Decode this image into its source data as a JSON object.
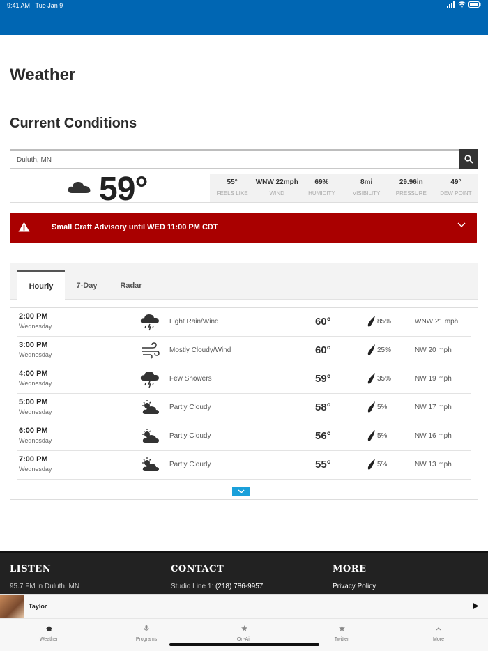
{
  "status_bar": {
    "time": "9:41 AM",
    "date": "Tue Jan 9"
  },
  "page": {
    "title": "Weather",
    "section_title": "Current Conditions"
  },
  "search": {
    "value": "Duluth, MN"
  },
  "current": {
    "icon": "cloud-icon",
    "temp": "59°",
    "stats": [
      {
        "value": "55°",
        "label": "FEELS LIKE"
      },
      {
        "value": "WNW 22mph",
        "label": "WIND"
      },
      {
        "value": "69%",
        "label": "HUMIDITY"
      },
      {
        "value": "8mi",
        "label": "VISIBILITY"
      },
      {
        "value": "29.96in",
        "label": "PRESSURE"
      },
      {
        "value": "49°",
        "label": "DEW POINT"
      }
    ]
  },
  "alert": {
    "text": "Small Craft Advisory until WED 11:00 PM CDT",
    "color": "#a90000"
  },
  "tabs": [
    {
      "label": "Hourly"
    },
    {
      "label": "7-Day"
    },
    {
      "label": "Radar"
    }
  ],
  "hourly": [
    {
      "time": "2:00 PM",
      "day": "Wednesday",
      "icon": "rain-icon",
      "desc": "Light Rain/Wind",
      "temp": "60°",
      "precip": "85%",
      "wind": "WNW 21 mph"
    },
    {
      "time": "3:00 PM",
      "day": "Wednesday",
      "icon": "wind-icon",
      "desc": "Mostly Cloudy/Wind",
      "temp": "60°",
      "precip": "25%",
      "wind": "NW 20 mph"
    },
    {
      "time": "4:00 PM",
      "day": "Wednesday",
      "icon": "rain-icon",
      "desc": "Few Showers",
      "temp": "59°",
      "precip": "35%",
      "wind": "NW 19 mph"
    },
    {
      "time": "5:00 PM",
      "day": "Wednesday",
      "icon": "partly-cloudy-icon",
      "desc": "Partly Cloudy",
      "temp": "58°",
      "precip": "5%",
      "wind": "NW 17 mph"
    },
    {
      "time": "6:00 PM",
      "day": "Wednesday",
      "icon": "partly-cloudy-icon",
      "desc": "Partly Cloudy",
      "temp": "56°",
      "precip": "5%",
      "wind": "NW 16 mph"
    },
    {
      "time": "7:00 PM",
      "day": "Wednesday",
      "icon": "partly-cloudy-icon",
      "desc": "Partly Cloudy",
      "temp": "55°",
      "precip": "5%",
      "wind": "NW 13 mph"
    }
  ],
  "footer": {
    "listen": {
      "title": "LISTEN",
      "text": "95.7 FM in Duluth, MN"
    },
    "contact": {
      "title": "CONTACT",
      "label": "Studio Line 1:",
      "phone": "(218) 786-9957"
    },
    "more": {
      "title": "MORE",
      "text": "Privacy Policy"
    }
  },
  "player": {
    "name": "Taylor"
  },
  "nav": [
    {
      "label": "Weather",
      "icon": "home-icon"
    },
    {
      "label": "Programs",
      "icon": "microphone-icon"
    },
    {
      "label": "On-Air",
      "icon": "star-icon"
    },
    {
      "label": "Twitter",
      "icon": "star-icon"
    },
    {
      "label": "More",
      "icon": "chevron-up-icon"
    }
  ],
  "colors": {
    "header": "#0066b3",
    "alert": "#a90000",
    "accent": "#1aa0da",
    "footer": "#222222"
  }
}
